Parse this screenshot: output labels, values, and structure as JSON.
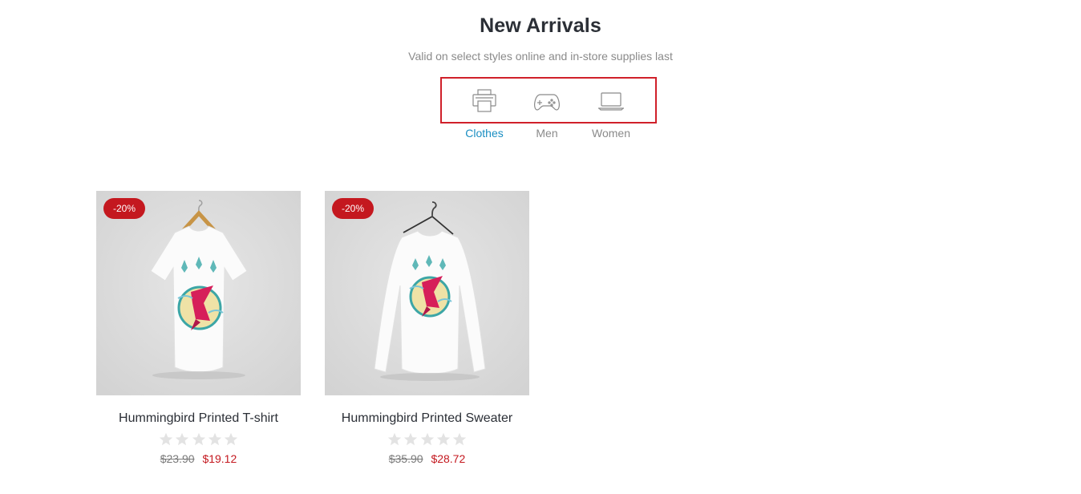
{
  "section": {
    "title": "New Arrivals",
    "subtitle": "Valid on select styles online and in-store supplies last"
  },
  "tabs": [
    {
      "label": "Clothes",
      "icon": "printer-icon",
      "active": true
    },
    {
      "label": "Men",
      "icon": "gamepad-icon",
      "active": false
    },
    {
      "label": "Women",
      "icon": "laptop-icon",
      "active": false
    }
  ],
  "colors": {
    "accent_active_tab": "#1a8ec2",
    "badge": "#c4181f",
    "sale_price": "#c4181f",
    "highlight_box": "#d0202a"
  },
  "products": [
    {
      "name": "Hummingbird Printed T-shirt",
      "badge": "-20%",
      "old_price": "$23.90",
      "new_price": "$19.12",
      "rating": 0,
      "image": "white-tshirt-on-hanger"
    },
    {
      "name": "Hummingbird Printed Sweater",
      "badge": "-20%",
      "old_price": "$35.90",
      "new_price": "$28.72",
      "rating": 0,
      "image": "white-longsleeve-on-hanger"
    }
  ]
}
